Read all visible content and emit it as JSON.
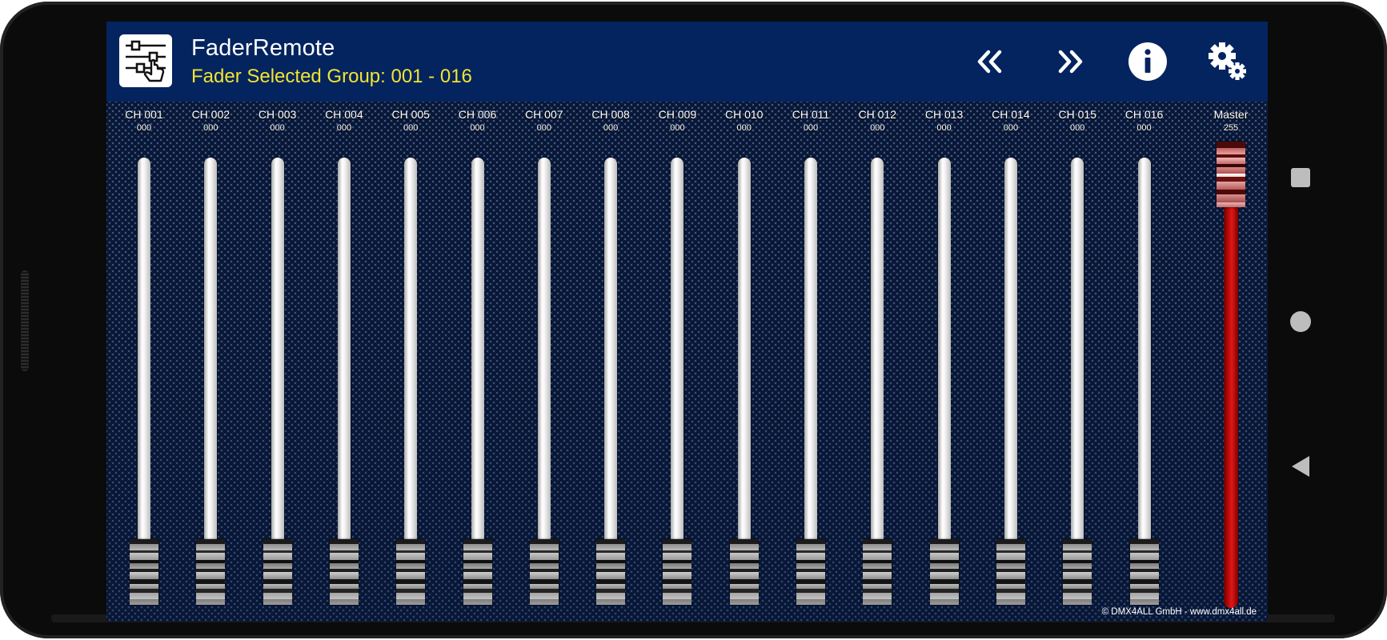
{
  "app": {
    "title": "FaderRemote",
    "subtitle": "Fader Selected Group: 001 - 016",
    "icon": "fader-app-icon"
  },
  "actions": [
    {
      "name": "previous-group",
      "icon": "double-chevron-left-icon"
    },
    {
      "name": "next-group",
      "icon": "double-chevron-right-icon"
    },
    {
      "name": "info",
      "icon": "info-icon"
    },
    {
      "name": "settings",
      "icon": "gear-icon"
    }
  ],
  "channels": [
    {
      "label": "CH 001",
      "value": "000",
      "level": 0
    },
    {
      "label": "CH 002",
      "value": "000",
      "level": 0
    },
    {
      "label": "CH 003",
      "value": "000",
      "level": 0
    },
    {
      "label": "CH 004",
      "value": "000",
      "level": 0
    },
    {
      "label": "CH 005",
      "value": "000",
      "level": 0
    },
    {
      "label": "CH 006",
      "value": "000",
      "level": 0
    },
    {
      "label": "CH 007",
      "value": "000",
      "level": 0
    },
    {
      "label": "CH 008",
      "value": "000",
      "level": 0
    },
    {
      "label": "CH 009",
      "value": "000",
      "level": 0
    },
    {
      "label": "CH 010",
      "value": "000",
      "level": 0
    },
    {
      "label": "CH 011",
      "value": "000",
      "level": 0
    },
    {
      "label": "CH 012",
      "value": "000",
      "level": 0
    },
    {
      "label": "CH 013",
      "value": "000",
      "level": 0
    },
    {
      "label": "CH 014",
      "value": "000",
      "level": 0
    },
    {
      "label": "CH 015",
      "value": "000",
      "level": 0
    },
    {
      "label": "CH 016",
      "value": "000",
      "level": 0
    }
  ],
  "master": {
    "label": "Master",
    "value": "255",
    "level": 255
  },
  "footer": {
    "copyright": "© DMX4ALL GmbH - www.dmx4all.de"
  },
  "navbar": [
    "recents-icon",
    "home-icon",
    "back-icon"
  ],
  "colors": {
    "appbar": "#04245f",
    "subtitle": "#f2e431",
    "master_fader": "#d01010"
  }
}
